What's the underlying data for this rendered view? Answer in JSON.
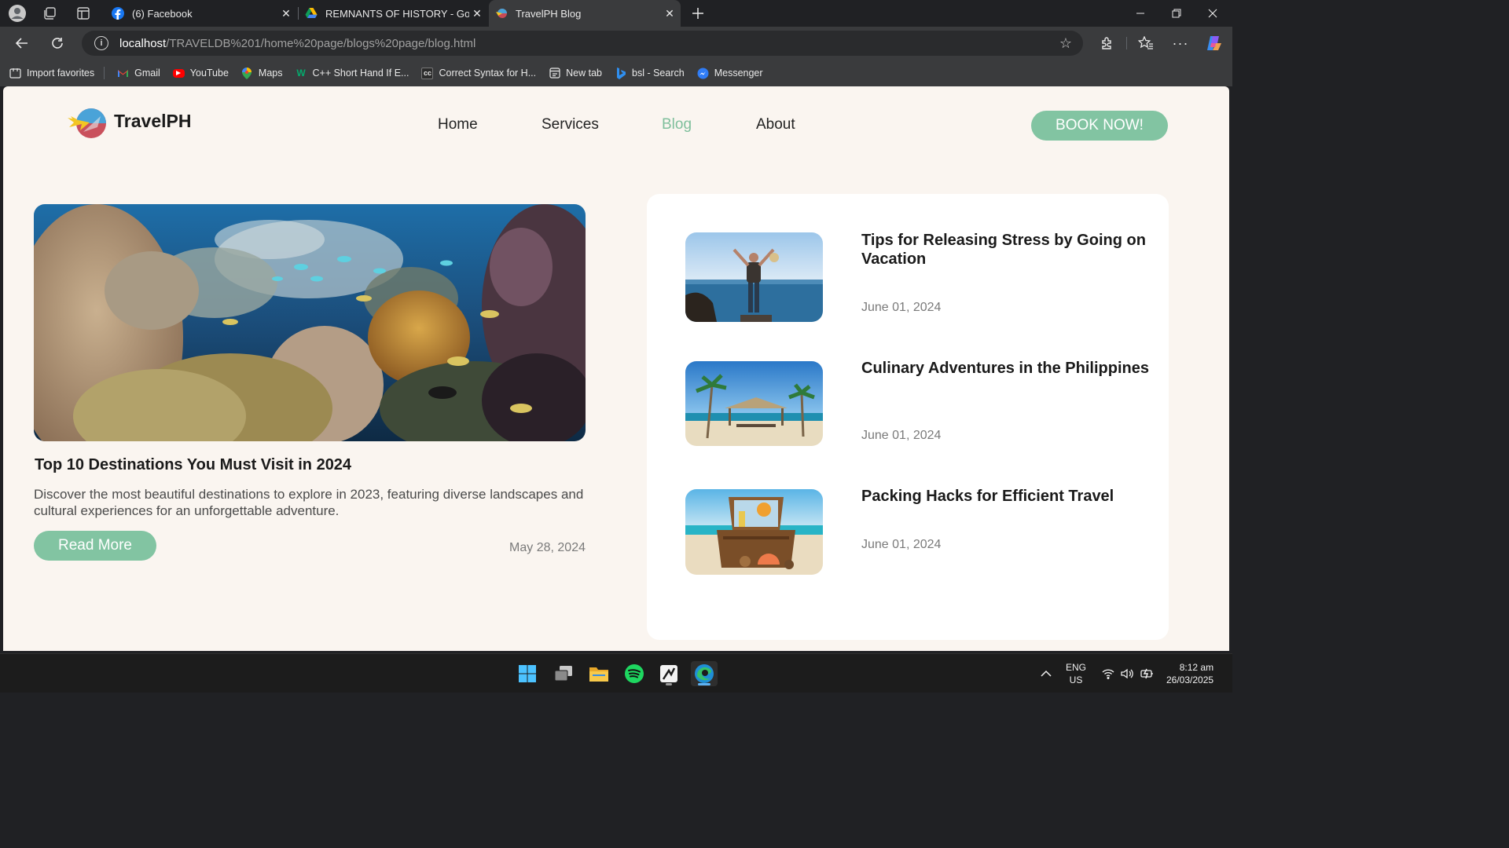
{
  "browser": {
    "tabs": [
      {
        "title": "(6) Facebook",
        "favicon": "facebook-icon",
        "active": false
      },
      {
        "title": "REMNANTS OF HISTORY - Google Drive",
        "favicon": "google-drive-icon",
        "active": false
      },
      {
        "title": "TravelPH Blog",
        "favicon": "travelph-icon",
        "active": true
      }
    ],
    "address": {
      "host": "localhost",
      "path": "/TRAVELDB%201/home%20page/blogs%20page/blog.html"
    },
    "bookmarks": [
      {
        "label": "Import favorites",
        "icon": "import-icon"
      },
      {
        "label": "Gmail",
        "icon": "gmail-icon"
      },
      {
        "label": "YouTube",
        "icon": "youtube-icon"
      },
      {
        "label": "Maps",
        "icon": "maps-icon"
      },
      {
        "label": "C++ Short Hand If E...",
        "icon": "w3schools-icon"
      },
      {
        "label": "Correct Syntax for H...",
        "icon": "cc-icon"
      },
      {
        "label": "New tab",
        "icon": "new-tab-icon"
      },
      {
        "label": "bsl - Search",
        "icon": "bing-icon"
      },
      {
        "label": "Messenger",
        "icon": "messenger-icon"
      }
    ]
  },
  "site": {
    "brand": "TravelPH",
    "nav": [
      {
        "label": "Home",
        "active": false
      },
      {
        "label": "Services",
        "active": false
      },
      {
        "label": "Blog",
        "active": true
      },
      {
        "label": "About",
        "active": false
      }
    ],
    "cta": "BOOK NOW!",
    "accent_color": "#82c4a2"
  },
  "featured": {
    "image": "coral-reef-image",
    "title": "Top 10 Destinations You Must Visit in 2024",
    "description": "Discover the most beautiful destinations to explore in 2023, featuring diverse landscapes and cultural experiences for an unforgettable adventure.",
    "button": "Read More",
    "date": "May 28, 2024"
  },
  "posts": [
    {
      "title": "Tips for Releasing Stress by Going on Vacation",
      "date": "June 01, 2024",
      "image": "traveler-by-sea-image"
    },
    {
      "title": "Culinary Adventures in the Philippines",
      "date": "June 01, 2024",
      "image": "beach-hut-image"
    },
    {
      "title": "Packing Hacks for Efficient Travel",
      "date": "June 01, 2024",
      "image": "beach-suitcase-image"
    }
  ],
  "taskbar": {
    "apps": [
      "windows-start-icon",
      "task-view-icon",
      "file-explorer-icon",
      "spotify-icon",
      "app-icon",
      "edge-icon"
    ],
    "lang": "ENG",
    "region": "US",
    "time": "8:12 am",
    "date": "26/03/2025"
  }
}
